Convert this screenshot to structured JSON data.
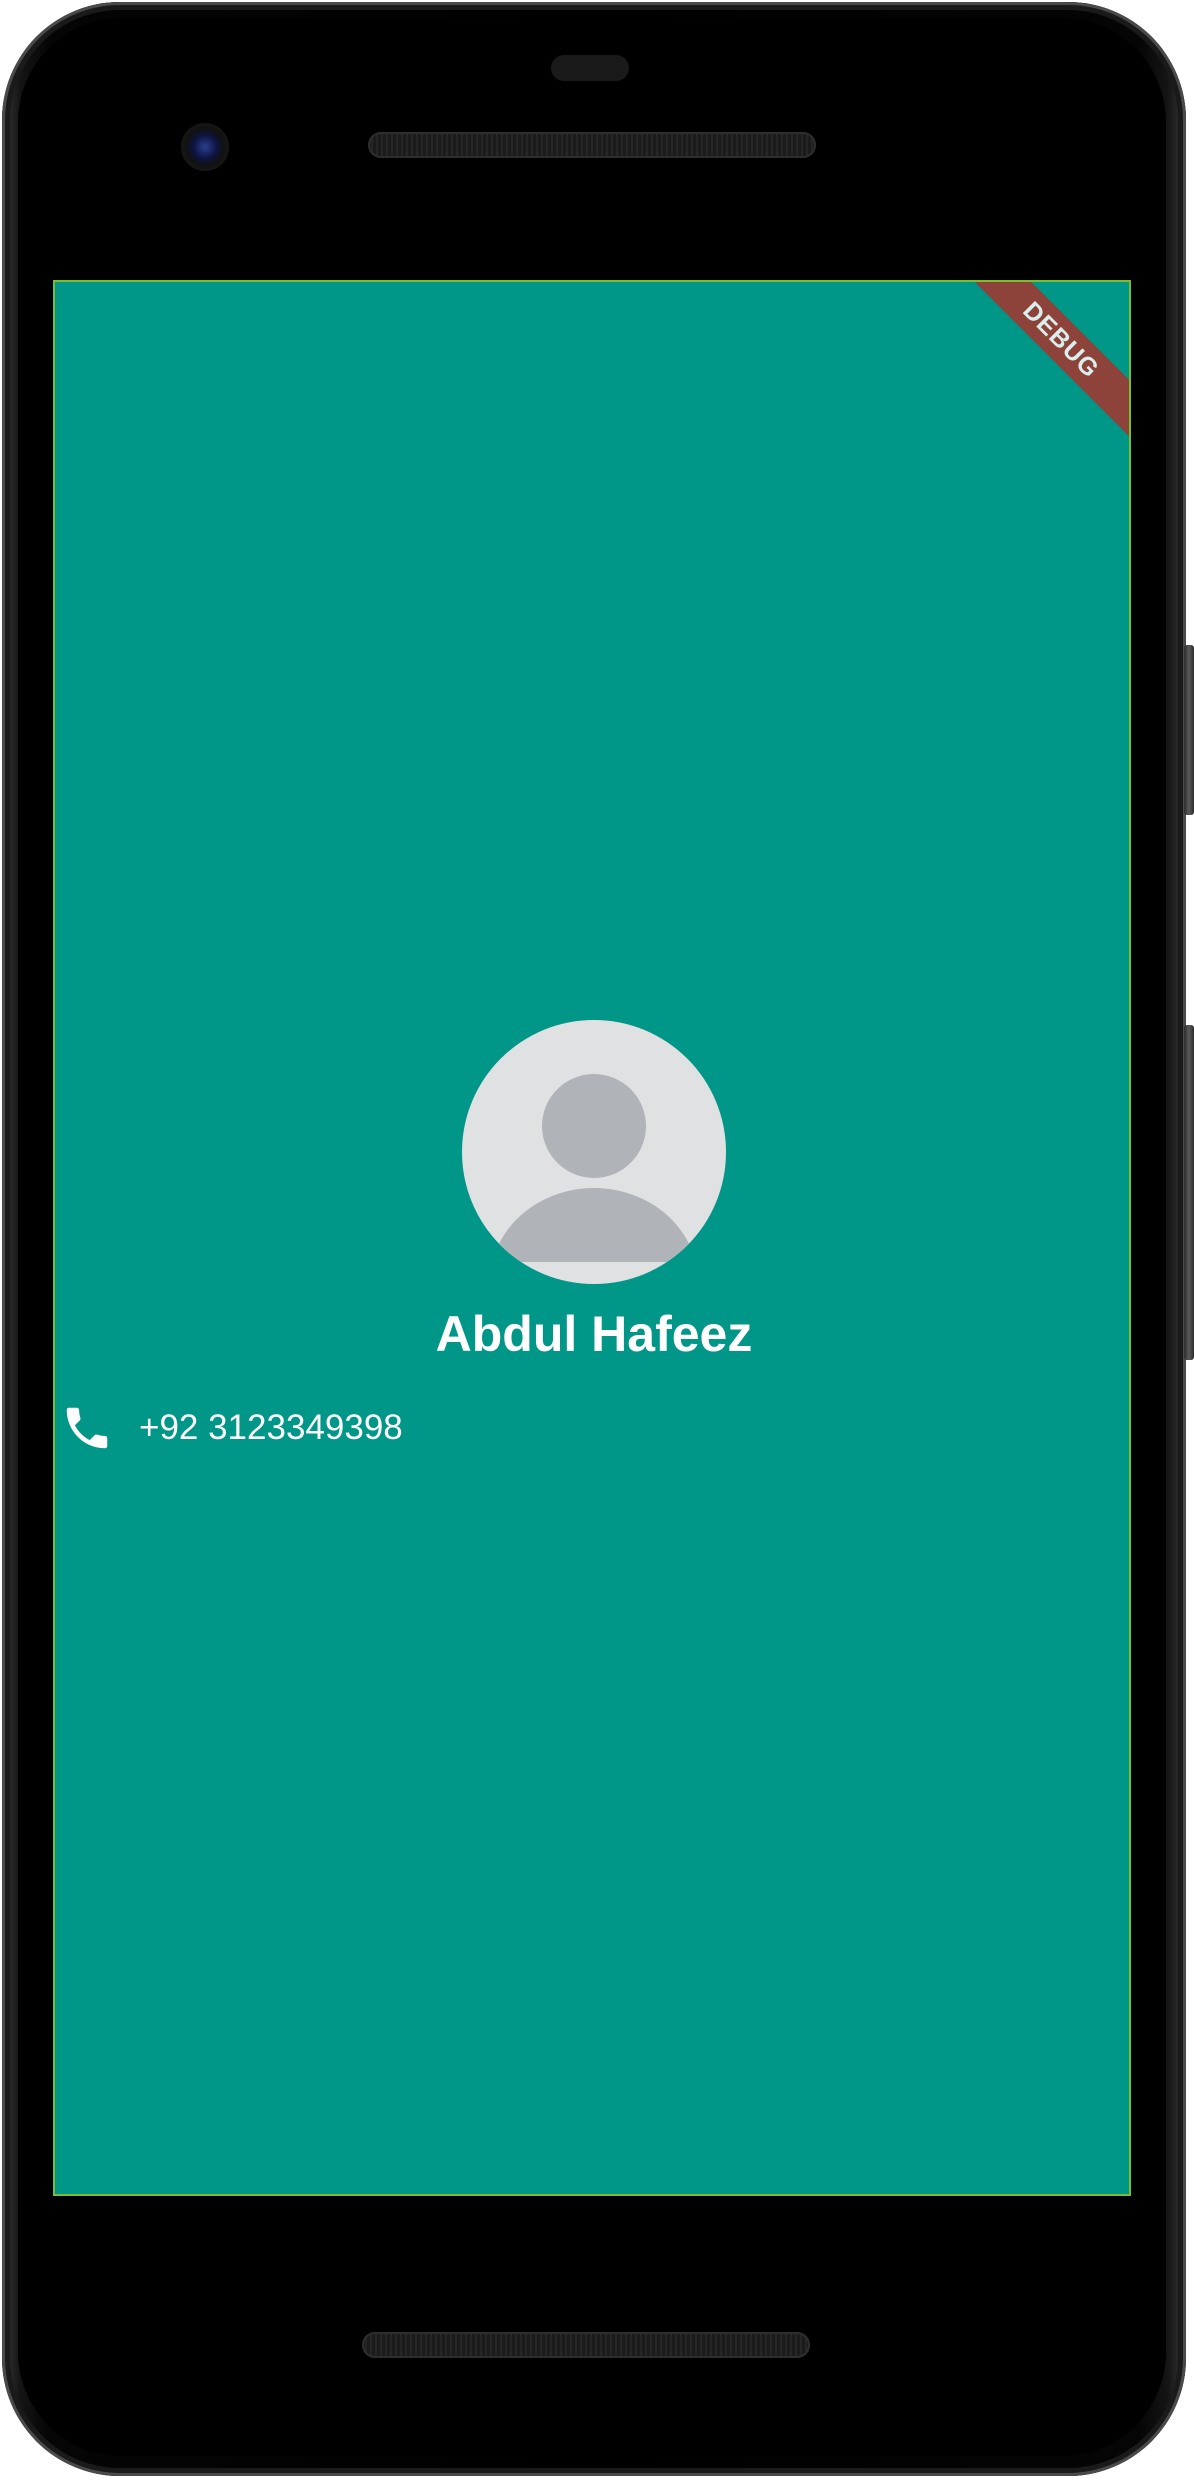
{
  "app": {
    "debug_banner": "DEBUG"
  },
  "contact": {
    "name": "Abdul Hafeez",
    "phone": "+92 3123349398",
    "avatar_icon": "person-placeholder-icon",
    "phone_icon": "phone-icon"
  },
  "colors": {
    "background": "#009688",
    "text": "#ffffff",
    "debug_banner": "#a6352c",
    "avatar_bg": "#e0e1e3",
    "avatar_silhouette": "#b0b3b7"
  }
}
